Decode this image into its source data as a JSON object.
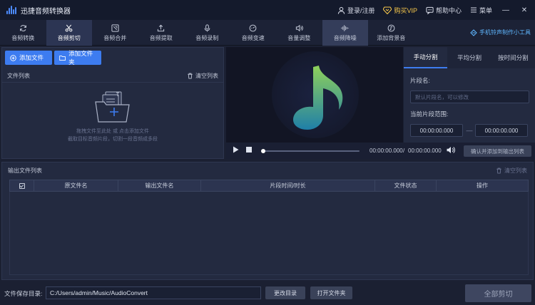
{
  "app": {
    "title": "迅捷音频转换器"
  },
  "header": {
    "login": "登录/注册",
    "vip": "购买VIP",
    "help": "帮助中心",
    "menu": "菜单"
  },
  "tools": [
    {
      "label": "音频转换",
      "icon": "refresh-icon"
    },
    {
      "label": "音频剪切",
      "icon": "scissors-icon"
    },
    {
      "label": "音频合并",
      "icon": "merge-icon"
    },
    {
      "label": "音频提取",
      "icon": "upload-icon"
    },
    {
      "label": "音频录制",
      "icon": "mic-icon"
    },
    {
      "label": "音频变速",
      "icon": "speed-icon"
    },
    {
      "label": "音量调整",
      "icon": "volume-icon"
    },
    {
      "label": "音频降噪",
      "icon": "waveform-icon"
    },
    {
      "label": "添加背景音",
      "icon": "music-note-icon"
    }
  ],
  "promo": "手机铃声制作小工具",
  "file_panel": {
    "add_file": "添加文件",
    "add_folder": "添加文件夹",
    "list_title": "文件列表",
    "clear_list": "清空列表",
    "hint_line1": "拖拽文件至此处 或 点击添加文件",
    "hint_line2": "截取目标音频片段，切割一段音频成多段"
  },
  "player": {
    "current_time": "00:00:00.000",
    "separator": "/",
    "total_time": "00:00:00.000",
    "progress": 0,
    "confirm_button": "确认并添加到输出列表"
  },
  "split": {
    "tabs": [
      "手动分割",
      "平均分割",
      "按时间分割"
    ],
    "active_tab": 0,
    "segment_name_label": "片段名:",
    "segment_name_placeholder": "默认片段名，可以修改",
    "range_label": "当前片段范围:",
    "range_start": "00:00:00.000",
    "range_dash": "—",
    "range_end": "00:00:00.000"
  },
  "output": {
    "title": "输出文件列表",
    "clear_list": "清空列表",
    "columns": [
      "原文件名",
      "输出文件名",
      "片段时间/时长",
      "文件状态",
      "操作"
    ]
  },
  "bottom": {
    "save_dir_label": "文件保存目录:",
    "save_dir_value": "C:/Users/admin/Music/AudioConvert",
    "change_dir": "更改目录",
    "open_folder": "打开文件夹",
    "cut_all": "全部剪切"
  },
  "colors": {
    "accent": "#3d7cf0",
    "vip": "#f7c84b",
    "note_top": "#8fd15a",
    "note_bottom": "#1f7fa8"
  }
}
